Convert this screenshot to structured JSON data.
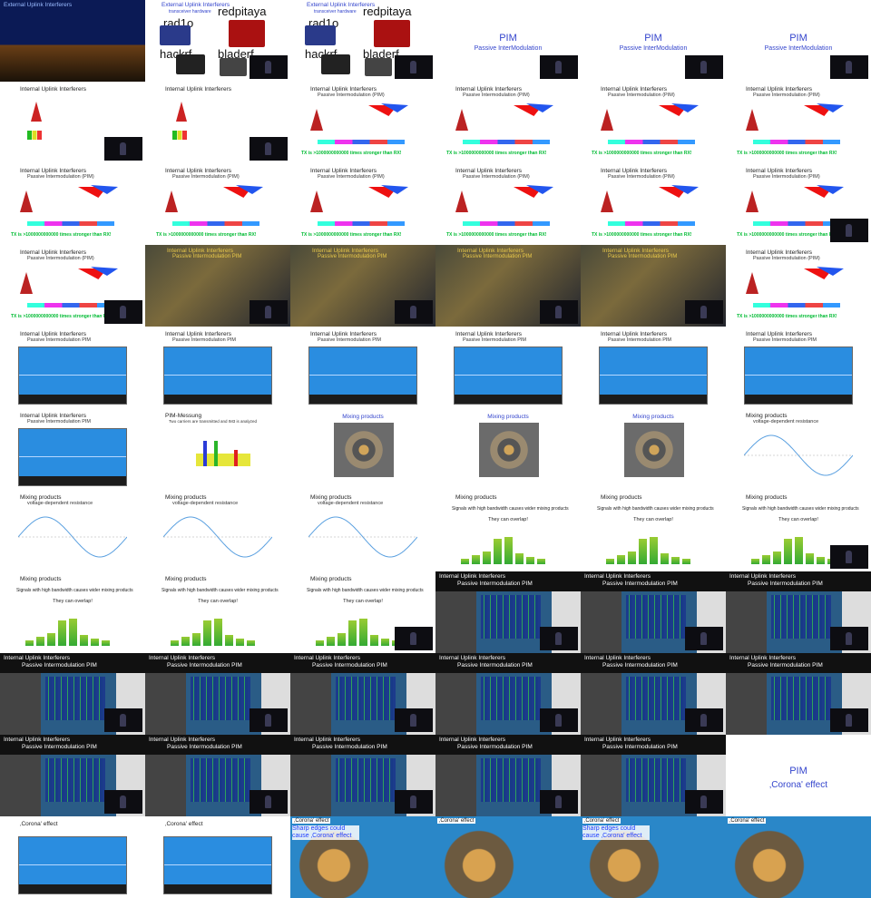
{
  "rows": [
    [
      "External Uplink Interferers",
      "External Uplink Interferers",
      "External Uplink Interferers",
      "PIM",
      "PIM",
      "PIM"
    ],
    [
      "Internal Uplink Interferers",
      "Internal Uplink Interferers",
      "Internal Uplink Interferers",
      "Internal Uplink Interferers",
      "Internal Uplink Interferers",
      "Internal Uplink Interferers"
    ],
    [
      "Internal Uplink Interferers",
      "Internal Uplink Interferers",
      "Internal Uplink Interferers",
      "Internal Uplink Interferers",
      "Internal Uplink Interferers",
      "Internal Uplink Interferers"
    ],
    [
      "Internal Uplink Interferers",
      "Internal Uplink Interferers",
      "Internal Uplink Interferers",
      "Internal Uplink Interferers",
      "Internal Uplink Interferers",
      "Internal Uplink Interferers"
    ],
    [
      "Internal Uplink Interferers",
      "Internal Uplink Interferers",
      "Internal Uplink Interferers",
      "Internal Uplink Interferers",
      "Internal Uplink Interferers",
      "Internal Uplink Interferers"
    ],
    [
      "Internal Uplink Interferers",
      "PIM-Messung",
      "Mixing products",
      "Mixing products",
      "Mixing products",
      "Mixing products"
    ],
    [
      "Mixing products",
      "Mixing products",
      "Mixing products",
      "Mixing products",
      "Mixing products",
      "Mixing products"
    ],
    [
      "Mixing products",
      "Mixing products",
      "Mixing products",
      "Internal Uplink Interferers",
      "Internal Uplink Interferers",
      "Internal Uplink Interferers"
    ],
    [
      "Internal Uplink Interferers",
      "Internal Uplink Interferers",
      "Internal Uplink Interferers",
      "Internal Uplink Interferers",
      "Internal Uplink Interferers",
      "Internal Uplink Interferers"
    ],
    [
      "Internal Uplink Interferers",
      "Internal Uplink Interferers",
      "Internal Uplink Interferers",
      "Internal Uplink Interferers",
      "Internal Uplink Interferers",
      "PIM"
    ],
    [
      "‚Corona' effect",
      "‚Corona' effect",
      "‚Corona' effect",
      "‚Corona' effect",
      "‚Corona' effect",
      "‚Corona' effect"
    ]
  ],
  "text": {
    "pim": "PIM",
    "passive_intermod": "Passive InterModulation",
    "passive_intermod_pim": "Passive Intermodulation PIM",
    "passive_intermod_paren": "Passive Intermodulation (PIM)",
    "corona_effect": "‚Corona' effect",
    "tx_stronger": "TX is >1000000000000 times stronger than RX!",
    "voltage_dep": "voltage-dependent resistance",
    "high_bw": "Signals with high bandwidth causes wider mixing products",
    "overlap": "They can overlap!",
    "sharp_edges": "Sharp edges could cause ‚Corona' effect",
    "sdr_rad1o": "rad1o",
    "sdr_redpitaya": "redpitaya",
    "sdr_hackrf": "hackrf",
    "sdr_bladerf": "bladerf",
    "pim_messung": "PIM-Messung",
    "pim_messung_sub": "Two carriers are transmitted and IM3 is analyzed",
    "transceiver_hw": "transceiver hardware"
  }
}
